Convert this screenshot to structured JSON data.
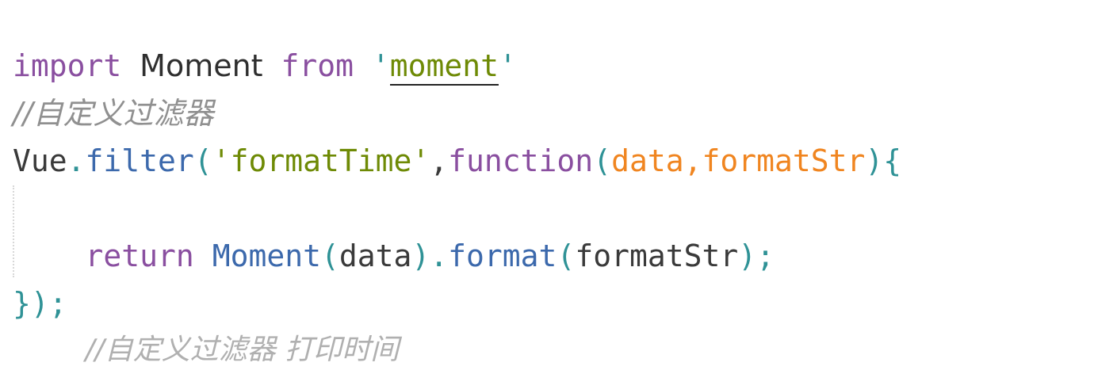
{
  "editor": {
    "line1": {
      "import_kw": "import",
      "module_name": "Moment",
      "from_kw": "from",
      "quote_open": "'",
      "module_path": "moment",
      "quote_close": "'"
    },
    "line2": {
      "comment": "//自定义过滤器"
    },
    "line3": {
      "object": "Vue",
      "dot": ".",
      "method": "filter",
      "paren_open": "(",
      "filter_name": "'formatTime'",
      "comma": ",",
      "function_kw": "function",
      "params_open": "(",
      "param1": "data",
      "param_comma": ",",
      "param2": "formatStr",
      "params_close": ")",
      "brace_open": "{"
    },
    "line5": {
      "return_kw": "return",
      "call_name": "Moment",
      "call_open": "(",
      "call_arg": "data",
      "call_close": ")",
      "dot": ".",
      "format_method": "format",
      "format_open": "(",
      "format_arg": "formatStr",
      "format_close": ")",
      "semicolon": ";"
    },
    "line6": {
      "closing": "});"
    },
    "line7": {
      "cutoff_text": "//自定义过滤器 打印时间"
    }
  },
  "colors": {
    "keyword": "#8a4fa0",
    "string": "#6e8a05",
    "function": "#3c69ac",
    "punctuation": "#2f9296",
    "parameter": "#f08520",
    "comment": "#909090"
  }
}
